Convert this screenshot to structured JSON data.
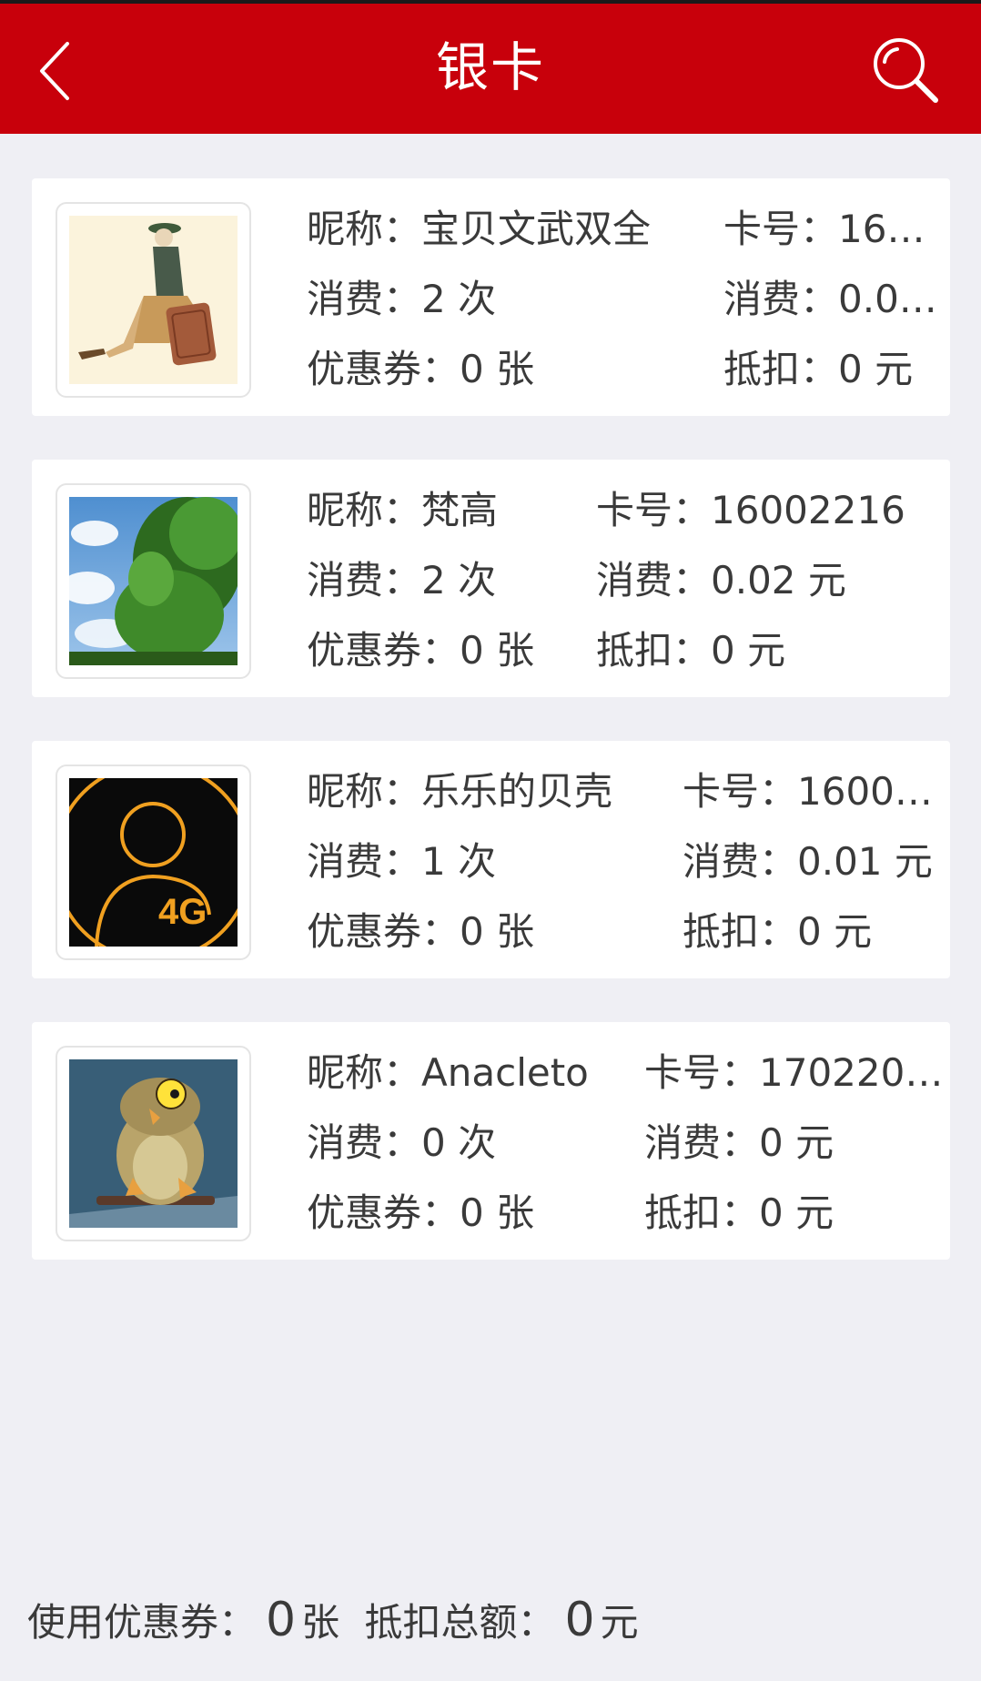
{
  "header": {
    "title": "银卡"
  },
  "cards": [
    {
      "nickname_label": "昵称：",
      "nickname": "宝贝文武双全",
      "card_no_label": "卡号：",
      "card_no": "16…",
      "visits_label": "消费：",
      "visits": "2 次",
      "spend_label": "消费：",
      "spend": "0.0…",
      "coupon_label": "优惠券：",
      "coupon": "0 张",
      "deduct_label": "抵扣：",
      "deduct": "0 元",
      "avatar": "girl-with-suitcase-illustration"
    },
    {
      "nickname_label": "昵称：",
      "nickname": "梵高",
      "card_no_label": "卡号：",
      "card_no": "16002216",
      "visits_label": "消费：",
      "visits": "2 次",
      "spend_label": "消费：",
      "spend": "0.02 元",
      "coupon_label": "优惠券：",
      "coupon": "0 张",
      "deduct_label": "抵扣：",
      "deduct": "0 元",
      "avatar": "tree-and-sky-photo"
    },
    {
      "nickname_label": "昵称：",
      "nickname": "乐乐的贝壳",
      "card_no_label": "卡号：",
      "card_no": "1600…",
      "visits_label": "消费：",
      "visits": "1 次",
      "spend_label": "消费：",
      "spend": "0.01 元",
      "coupon_label": "优惠券：",
      "coupon": "0 张",
      "deduct_label": "抵扣：",
      "deduct": "0 元",
      "avatar": "4g-user-icon",
      "avatar_text": "4G"
    },
    {
      "nickname_label": "昵称：",
      "nickname": "Anacleto",
      "card_no_label": "卡号：",
      "card_no": "170220…",
      "visits_label": "消费：",
      "visits": "0 次",
      "spend_label": "消费：",
      "spend": "0 元",
      "coupon_label": "优惠券：",
      "coupon": "0 张",
      "deduct_label": "抵扣：",
      "deduct": "0 元",
      "avatar": "cartoon-owl"
    }
  ],
  "footer": {
    "coupon_label": "使用优惠券：",
    "coupon_value": "0",
    "coupon_unit": "张",
    "total_label": "抵扣总额：",
    "total_value": "0",
    "total_unit": "元"
  },
  "colors": {
    "brand_red": "#c8000b",
    "background": "#efeff4",
    "card": "#ffffff",
    "text": "#3a3a3a"
  }
}
